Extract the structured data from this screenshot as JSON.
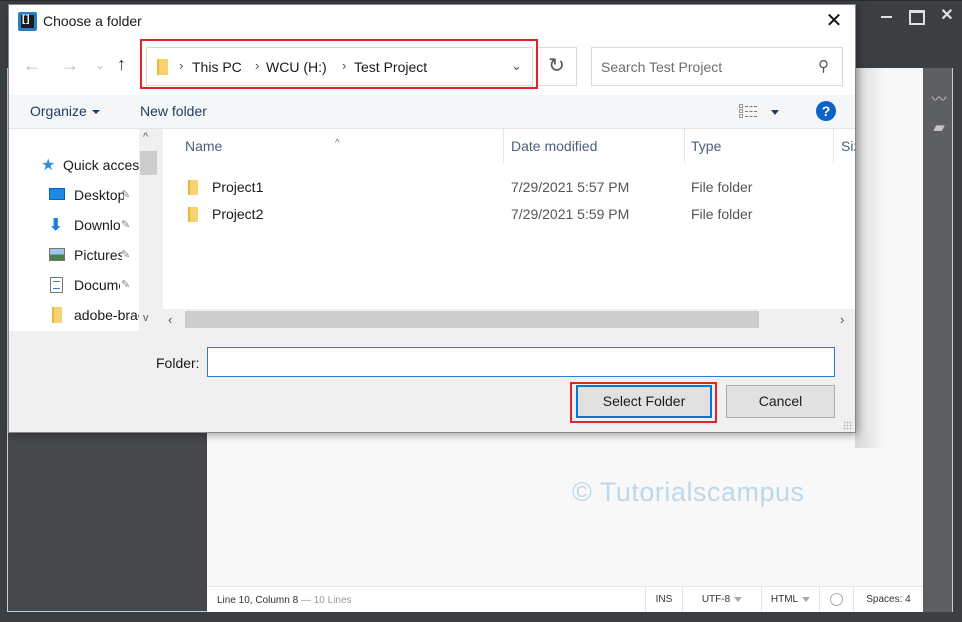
{
  "app": {
    "window_controls": {
      "minimize": "—",
      "maximize": "☐",
      "close": "✕"
    },
    "watermark": "© Tutorialscampus",
    "statusbar": {
      "cursor": "Line 10, Column 8",
      "lines": "— 10 Lines",
      "mode": "INS",
      "encoding": "UTF-8",
      "language": "HTML",
      "spaces": "Spaces:  4"
    },
    "right_toolbar": {
      "live_preview_icon": "〰",
      "extensions_icon": "▰"
    }
  },
  "dialog": {
    "title": "Choose a folder",
    "close": "✕",
    "nav": {
      "back": "←",
      "forward": "→",
      "recent": "⌄",
      "up": "↑"
    },
    "breadcrumb": [
      "This PC",
      "WCU (H:)",
      "Test Project"
    ],
    "breadcrumb_sep": "›",
    "address_dropdown": "⌄",
    "refresh": "↻",
    "search": {
      "placeholder": "Search Test Project",
      "icon": "⚲"
    },
    "commands": {
      "organize": "Organize",
      "new_folder": "New folder",
      "help": "?"
    },
    "nav_pane": {
      "items": [
        {
          "label": "Quick access",
          "icon": "star-icon",
          "pinned": false
        },
        {
          "label": "Desktop",
          "icon": "desktop-icon",
          "pinned": true
        },
        {
          "label": "Downloads",
          "icon": "download-icon",
          "pinned": true
        },
        {
          "label": "Pictures",
          "icon": "pictures-icon",
          "pinned": true
        },
        {
          "label": "Documents",
          "icon": "documents-icon",
          "pinned": true
        },
        {
          "label": "adobe-brackets",
          "icon": "folder-icon",
          "pinned": false
        }
      ],
      "pin_glyph": "📌",
      "scroll_up": "^",
      "scroll_down": "v"
    },
    "file_list": {
      "columns": [
        "Name",
        "Date modified",
        "Type",
        "Size"
      ],
      "sort_indicator": "^",
      "rows": [
        {
          "name": "Project1",
          "date": "7/29/2021 5:57 PM",
          "type": "File folder"
        },
        {
          "name": "Project2",
          "date": "7/29/2021 5:59 PM",
          "type": "File folder"
        }
      ],
      "scroll_left": "‹",
      "scroll_right": "›"
    },
    "folder_field": {
      "label": "Folder:",
      "value": ""
    },
    "buttons": {
      "select": "Select Folder",
      "cancel": "Cancel"
    }
  },
  "colors": {
    "highlight_red": "#e0242b",
    "accent_blue": "#0078d7",
    "link_text": "#1e3e63",
    "watermark": "#bcd8ef"
  }
}
